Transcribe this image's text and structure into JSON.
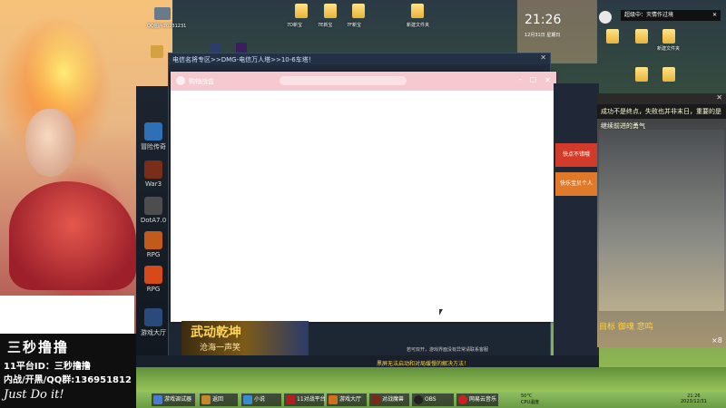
{
  "streamer": {
    "name": "三秒撸撸",
    "platform_id": "11平台ID：三秒撸撸",
    "qq_group": "内战/开黑/QQ群:136951812",
    "slogan": "Just Do it!"
  },
  "desktop": {
    "icons": [
      {
        "label": "QQ图片20231231"
      },
      {
        "label": "7D新宝"
      },
      {
        "label": "7E新宝"
      },
      {
        "label": "7F新宝"
      },
      {
        "label": "新建文件夹"
      },
      {
        "label": "新建文件夹"
      }
    ]
  },
  "clock_widget": {
    "time": "21:26",
    "date": "12月31日 星期日"
  },
  "tooltip": {
    "text": "超级中：灭情作过境"
  },
  "launcher": {
    "tiles": [
      {
        "label": "冒险传奇",
        "color": "#2f6fb5"
      },
      {
        "label": "War3",
        "color": "#7a2d18"
      },
      {
        "label": "DotA7.0",
        "color": "#4d4d4d"
      },
      {
        "label": "RPG",
        "color": "#c25a1c"
      },
      {
        "label": "RPG",
        "color": "#d64a1a"
      },
      {
        "label": "游戏大厅",
        "color": "#294a7a"
      }
    ]
  },
  "bg_app": {
    "title": "电信名将专区>>DMG-电信万人塔>>10-6车塔！"
  },
  "main_window": {
    "title": "购物战盒"
  },
  "side_panel": {
    "buttons": [
      {
        "label": "快点不错哦",
        "color": "#d23a2a"
      },
      {
        "label": "快乐宝贝个人",
        "color": "#e07a2a"
      }
    ]
  },
  "game_window": {
    "banner": "成功不是终点，失败也并非末日，重要的是继续前进的勇气",
    "hud": "目标 御魂 悲鸣",
    "counter": "×8"
  },
  "notice": {
    "text": "黑屏无法启动和对局缓慢的解决方法！"
  },
  "status_small": {
    "text": "若可双开，游戏界面没有异常请联系客服"
  },
  "banner_ad": {
    "title": "武动乾坤",
    "subtitle": "沧海一声笑"
  },
  "taskbar": {
    "items": [
      {
        "label": "游戏调试器",
        "color": "#4a7bd0"
      },
      {
        "label": "返回",
        "color": "#c08a2a"
      },
      {
        "label": "小说",
        "color": "#3a8ad0"
      },
      {
        "label": "11对战平台",
        "color": "#b02020"
      },
      {
        "label": "游戏大厅",
        "color": "#d0701a"
      },
      {
        "label": "对战魔兽",
        "color": "#7a2a1a"
      },
      {
        "label": "OBS",
        "color": "#222222"
      },
      {
        "label": "网易云音乐",
        "color": "#d02020"
      }
    ],
    "tray": {
      "temp": "50°C",
      "cpu": "CPU温度",
      "time": "21:26",
      "date": "2023/12/31"
    }
  }
}
